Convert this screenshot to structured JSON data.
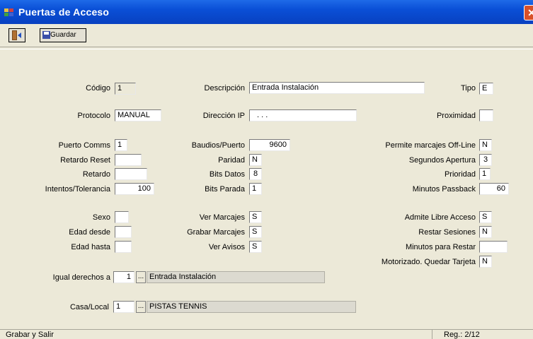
{
  "window": {
    "title": "Puertas de Acceso",
    "close_glyph": "✕"
  },
  "toolbar": {
    "save_label": "Guardar"
  },
  "fields": {
    "codigo": {
      "label": "Código",
      "value": "1"
    },
    "descripcion": {
      "label": "Descripción",
      "value": "Entrada Instalación"
    },
    "tipo": {
      "label": "Tipo",
      "value": "E"
    },
    "protocolo": {
      "label": "Protocolo",
      "value": "MANUAL"
    },
    "direccion_ip": {
      "label": "Dirección IP",
      "value": ". . ."
    },
    "proximidad": {
      "label": "Proximidad",
      "value": ""
    },
    "puerto_comms": {
      "label": "Puerto Comms",
      "value": "1"
    },
    "retardo_reset": {
      "label": "Retardo Reset",
      "value": ""
    },
    "retardo": {
      "label": "Retardo",
      "value": ""
    },
    "intentos_tolerancia": {
      "label": "Intentos/Tolerancia",
      "value": "100"
    },
    "baudios_puerto": {
      "label": "Baudios/Puerto",
      "value": "9600"
    },
    "paridad": {
      "label": "Paridad",
      "value": "N"
    },
    "bits_datos": {
      "label": "Bits Datos",
      "value": "8"
    },
    "bits_parada": {
      "label": "Bits Parada",
      "value": "1"
    },
    "permite_marcajes_offline": {
      "label": "Permite marcajes Off-Line",
      "value": "N"
    },
    "segundos_apertura": {
      "label": "Segundos Apertura",
      "value": "3"
    },
    "prioridad": {
      "label": "Prioridad",
      "value": "1"
    },
    "minutos_passback": {
      "label": "Minutos Passback",
      "value": "60"
    },
    "sexo": {
      "label": "Sexo",
      "value": ""
    },
    "edad_desde": {
      "label": "Edad desde",
      "value": ""
    },
    "edad_hasta": {
      "label": "Edad hasta",
      "value": ""
    },
    "ver_marcajes": {
      "label": "Ver Marcajes",
      "value": "S"
    },
    "grabar_marcajes": {
      "label": "Grabar Marcajes",
      "value": "S"
    },
    "ver_avisos": {
      "label": "Ver Avisos",
      "value": "S"
    },
    "admite_libre_acceso": {
      "label": "Admite Libre Acceso",
      "value": "S"
    },
    "restar_sesiones": {
      "label": "Restar Sesiones",
      "value": "N"
    },
    "minutos_para_restar": {
      "label": "Minutos para Restar",
      "value": ""
    },
    "motorizado_quedar_tarjeta": {
      "label": "Motorizado. Quedar Tarjeta",
      "value": "N"
    },
    "igual_derechos_a": {
      "label": "Igual derechos a",
      "value": "1",
      "lookup_button": "...",
      "lookup_text": "Entrada Instalación"
    },
    "casa_local": {
      "label": "Casa/Local",
      "value": "1",
      "lookup_button": "...",
      "lookup_text": "PISTAS TENNIS"
    }
  },
  "statusbar": {
    "left": "Grabar y Salir",
    "right": "Reg.: 2/12"
  },
  "colors": {
    "titlebar": "#0a4fd6",
    "window_bg": "#ece9d8",
    "field_bg": "#ffffff"
  }
}
